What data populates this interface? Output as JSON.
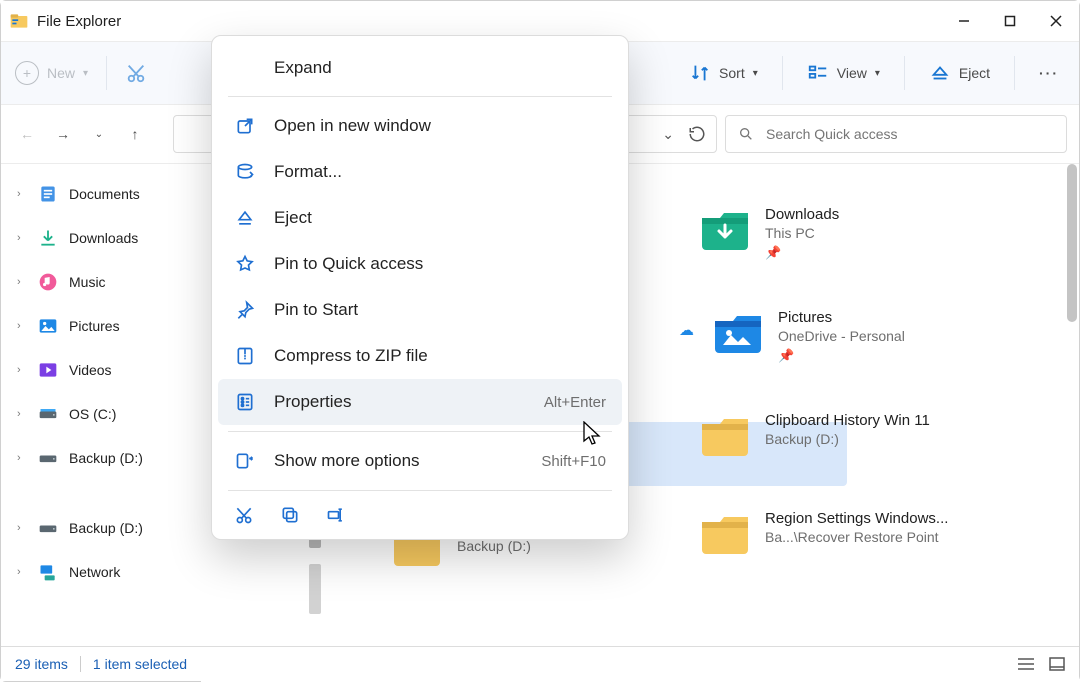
{
  "window": {
    "title": "File Explorer"
  },
  "toolbar": {
    "new_label": "New",
    "sort_label": "Sort",
    "view_label": "View",
    "eject_label": "Eject"
  },
  "search": {
    "placeholder": "Search Quick access"
  },
  "sidebar": {
    "items": [
      {
        "label": "Documents",
        "icon": "documents"
      },
      {
        "label": "Downloads",
        "icon": "downloads"
      },
      {
        "label": "Music",
        "icon": "music"
      },
      {
        "label": "Pictures",
        "icon": "pictures"
      },
      {
        "label": "Videos",
        "icon": "videos"
      },
      {
        "label": "OS (C:)",
        "icon": "drive-os"
      },
      {
        "label": "Backup (D:)",
        "icon": "drive"
      },
      {
        "label": "Backup (D:)",
        "icon": "drive"
      },
      {
        "label": "Network",
        "icon": "network"
      }
    ]
  },
  "tiles": [
    {
      "name": "Downloads",
      "sub": "This PC",
      "icon": "downloads",
      "pinned": true
    },
    {
      "name": "Pictures",
      "sub": "OneDrive - Personal",
      "icon": "pictures",
      "pinned": true,
      "cloud": true
    },
    {
      "name": "Clipboard History Win 11",
      "sub": "Backup (D:)",
      "icon": "folder"
    },
    {
      "name": "Region Settings Windows...",
      "sub": "Ba...\\Recover Restore Point",
      "icon": "folder"
    }
  ],
  "left_tile": {
    "sub": "Backup (D:)"
  },
  "context_menu": {
    "header": "Expand",
    "items": [
      {
        "label": "Open in new window",
        "icon": "open-new",
        "shortcut": ""
      },
      {
        "label": "Format...",
        "icon": "format",
        "shortcut": ""
      },
      {
        "label": "Eject",
        "icon": "eject",
        "shortcut": ""
      },
      {
        "label": "Pin to Quick access",
        "icon": "star",
        "shortcut": ""
      },
      {
        "label": "Pin to Start",
        "icon": "pin",
        "shortcut": ""
      },
      {
        "label": "Compress to ZIP file",
        "icon": "zip",
        "shortcut": ""
      },
      {
        "label": "Properties",
        "icon": "properties",
        "shortcut": "Alt+Enter",
        "hovered": true
      },
      {
        "label": "Show more options",
        "icon": "more",
        "shortcut": "Shift+F10"
      }
    ]
  },
  "status": {
    "items_count": "29 items",
    "selection": "1 item selected"
  },
  "colors": {
    "blue": "#0b67d0",
    "accent_green": "#1db28b",
    "folder": "#f7c95f"
  }
}
